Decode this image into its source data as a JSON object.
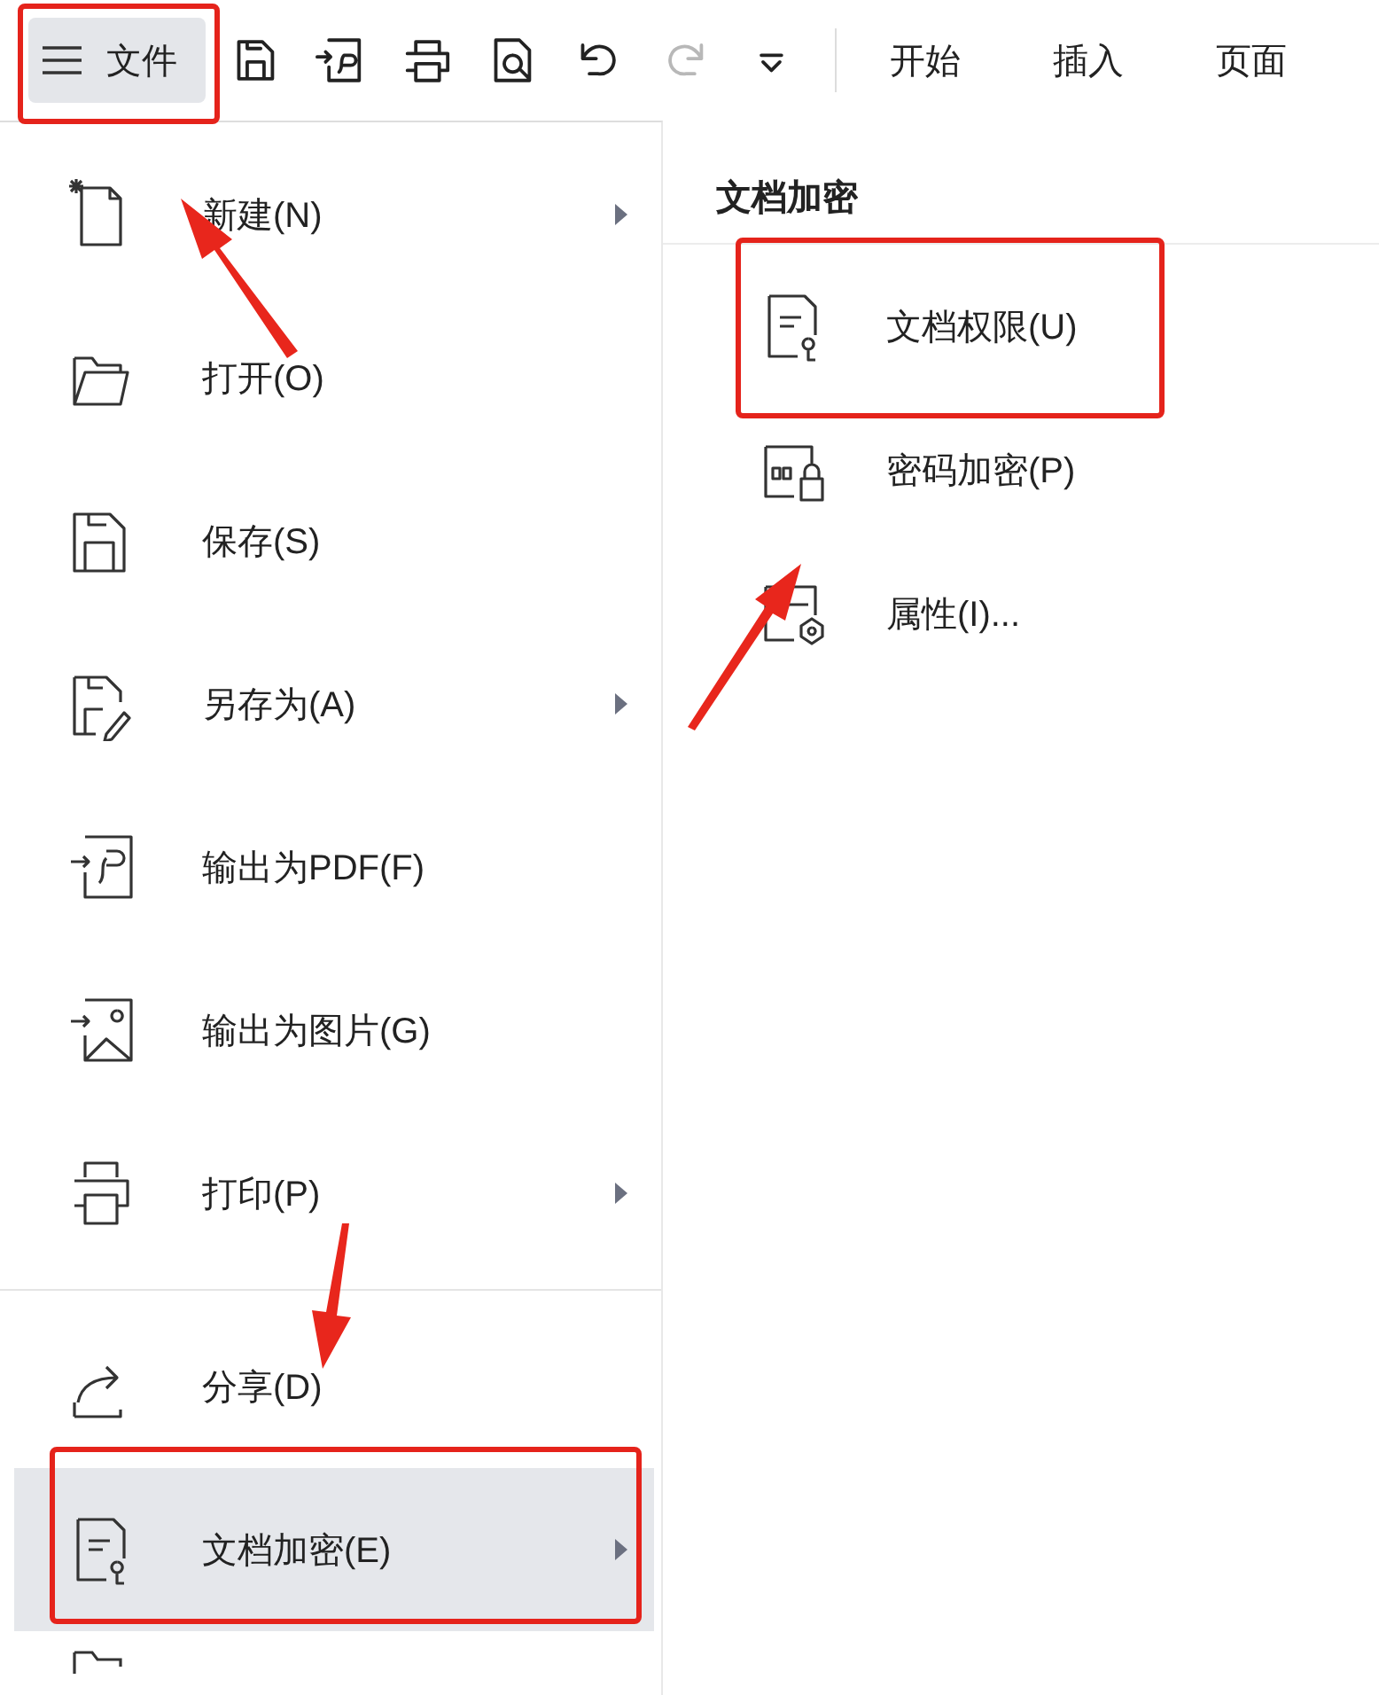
{
  "toolbar": {
    "file_button": {
      "label": "文件",
      "selected": true
    },
    "quick_actions": [
      {
        "disabled": false
      },
      {
        "disabled": false
      },
      {
        "disabled": false
      },
      {
        "disabled": false
      },
      {
        "disabled": false
      },
      {
        "disabled": true
      },
      {
        "disabled": false
      }
    ],
    "tabs": [
      {
        "label": "开始"
      },
      {
        "label": "插入"
      },
      {
        "label": "页面"
      }
    ]
  },
  "file_menu": {
    "groups": [
      [
        {
          "label": "新建(N)",
          "has_submenu": true,
          "selected": false
        },
        {
          "label": "打开(O)",
          "has_submenu": false,
          "selected": false
        },
        {
          "label": "保存(S)",
          "has_submenu": false,
          "selected": false
        },
        {
          "label": "另存为(A)",
          "has_submenu": true,
          "selected": false
        },
        {
          "label": "输出为PDF(F)",
          "has_submenu": false,
          "selected": false
        },
        {
          "label": "输出为图片(G)",
          "has_submenu": false,
          "selected": false
        },
        {
          "label": "打印(P)",
          "has_submenu": true,
          "selected": false
        }
      ],
      [
        {
          "label": "分享(D)",
          "has_submenu": false,
          "selected": false
        },
        {
          "label": "文档加密(E)",
          "has_submenu": true,
          "selected": true
        }
      ]
    ]
  },
  "submenu": {
    "title": "文档加密",
    "items": [
      {
        "label": "文档权限(U)"
      },
      {
        "label": "密码加密(P)"
      },
      {
        "label": "属性(I)..."
      }
    ]
  }
}
